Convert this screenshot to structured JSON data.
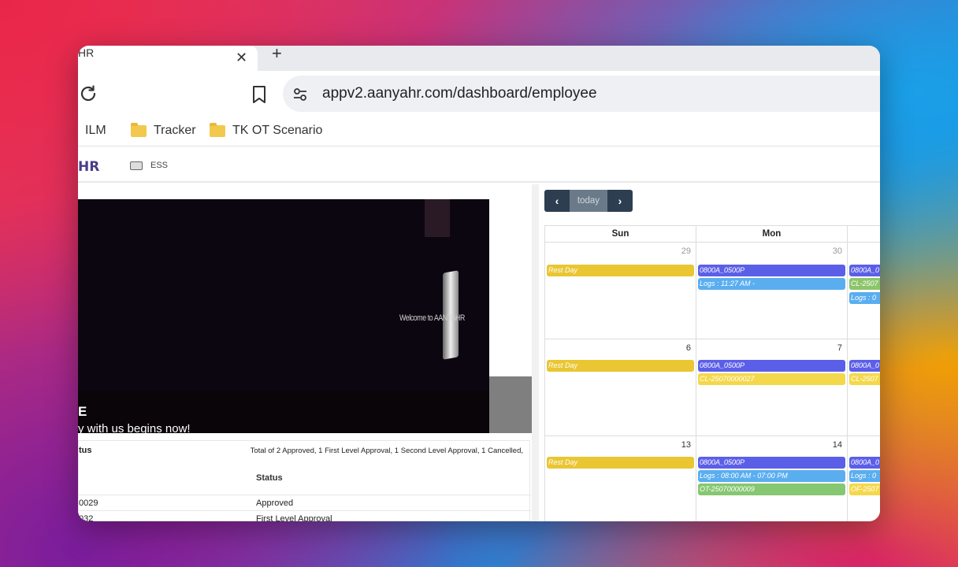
{
  "browser": {
    "tab_title": "HR",
    "tab_close": "✕",
    "new_tab": "+",
    "url": "appv2.aanyahr.com/dashboard/employee",
    "bookmarks": [
      "ILM",
      "Tracker",
      "TK OT Scenario"
    ]
  },
  "app": {
    "logo": "HR",
    "breadcrumb": "ESS"
  },
  "video": {
    "welcome_text": "Welcome to AANYAHR",
    "title_fragment": "E",
    "caption": "y with us begins now!"
  },
  "status_card": {
    "title": "tus",
    "total": "Total of 2 Approved, 1 First Level Approval, 1 Second Level Approval, 1 Cancelled,",
    "status_header": "Status",
    "rows": [
      {
        "id": "0029",
        "status": "Approved"
      },
      {
        "id": "032",
        "status": "First Level Approval"
      }
    ]
  },
  "calendar": {
    "prev": "‹",
    "today": "today",
    "next": "›",
    "days_of_week": [
      "Sun",
      "Mon"
    ],
    "weeks": [
      {
        "sun": {
          "day": "29",
          "events": [
            "Rest Day"
          ]
        },
        "mon": {
          "day": "30",
          "events": [
            "0800A_0500P",
            "Logs : 11:27 AM -"
          ]
        },
        "tue": {
          "events": [
            "0800A_0",
            "CL-2507",
            "Logs : 0"
          ]
        }
      },
      {
        "sun": {
          "day": "6",
          "events": [
            "Rest Day"
          ]
        },
        "mon": {
          "day": "7",
          "events": [
            "0800A_0500P",
            "CL-25070000027"
          ]
        },
        "tue": {
          "events": [
            "0800A_0",
            "CL-2507"
          ]
        }
      },
      {
        "sun": {
          "day": "13",
          "events": [
            "Rest Day"
          ]
        },
        "mon": {
          "day": "14",
          "events": [
            "0800A_0500P",
            "Logs : 08:00 AM - 07:00 PM",
            "OT-25070000009"
          ]
        },
        "tue": {
          "events": [
            "0800A_0",
            "Logs : 0",
            "OF-2507"
          ]
        }
      }
    ]
  }
}
